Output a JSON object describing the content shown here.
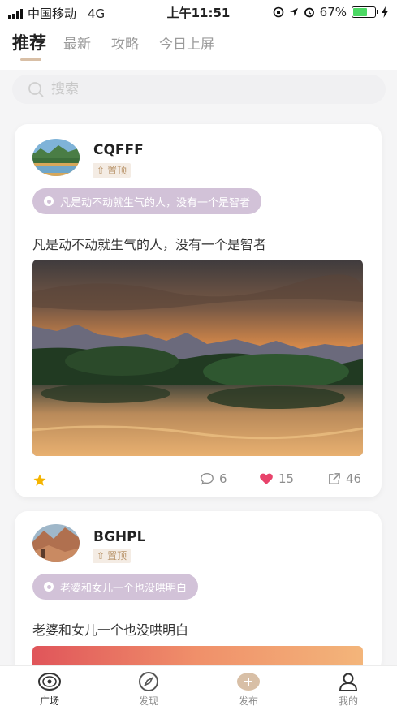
{
  "status_bar": {
    "carrier": "中国移动",
    "network": "4G",
    "time": "上午11:51",
    "battery_percent": "67%",
    "battery_level": 0.67
  },
  "tabs": [
    {
      "label": "推荐",
      "active": true
    },
    {
      "label": "最新",
      "active": false
    },
    {
      "label": "攻略",
      "active": false
    },
    {
      "label": "今日上屏",
      "active": false
    }
  ],
  "search": {
    "placeholder": "搜索"
  },
  "posts": [
    {
      "username": "CQFFF",
      "badge": "置顶",
      "topic": "凡是动不动就生气的人，没有一个是智者",
      "text": "凡是动不动就生气的人，没有一个是智者",
      "comments": "6",
      "likes": "15",
      "shares": "46"
    },
    {
      "username": "BGHPL",
      "badge": "置顶",
      "topic": "老婆和女儿一个也没哄明白",
      "text": "老婆和女儿一个也没哄明白"
    }
  ],
  "bottom_nav": [
    {
      "label": "广场",
      "icon": "plaza-icon",
      "active": true
    },
    {
      "label": "发现",
      "icon": "compass-icon",
      "active": false
    },
    {
      "label": "发布",
      "icon": "publish-plus-icon",
      "active": false
    },
    {
      "label": "我的",
      "icon": "user-icon",
      "active": false
    }
  ],
  "colors": {
    "accent": "#d8bfa6",
    "topic_pill": "#d2c2d8",
    "like": "#e8436b",
    "star": "#f5b400",
    "battery": "#4cd964"
  }
}
